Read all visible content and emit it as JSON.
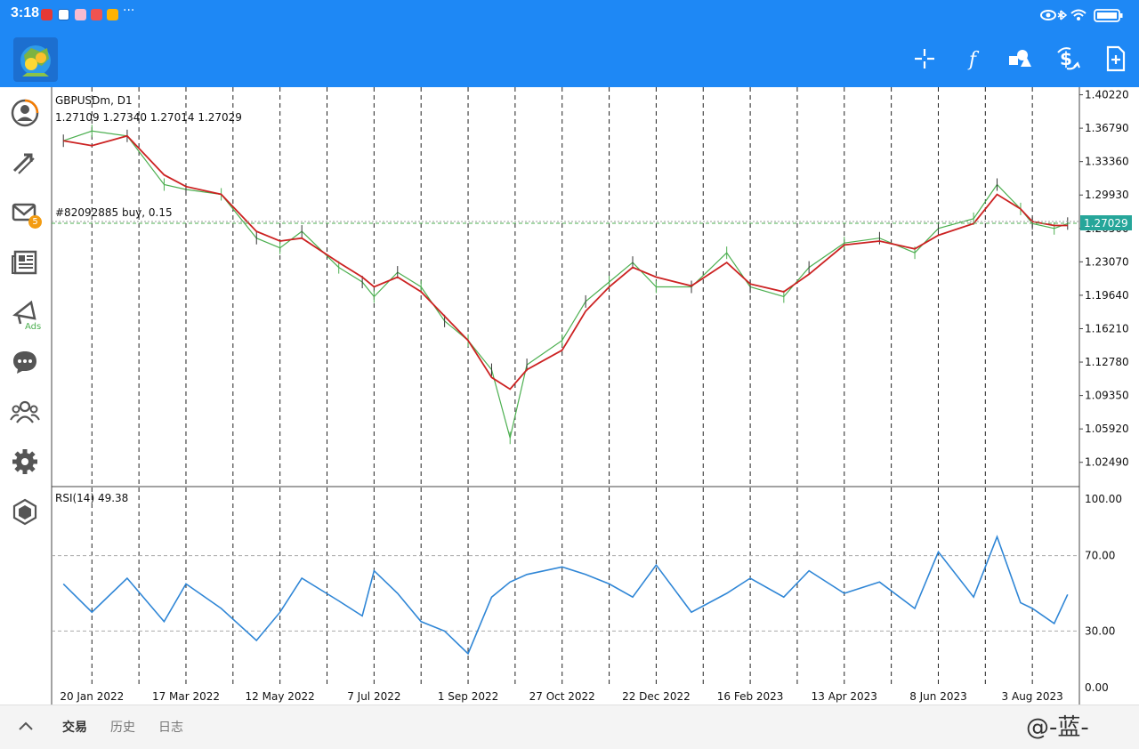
{
  "status_bar": {
    "time": "3:18",
    "colors": {
      "background": "#1e88f5"
    }
  },
  "app_bar": {
    "toolbar_icons": [
      "crosshair-icon",
      "function-icon",
      "shapes-icon",
      "dollar-sync-icon",
      "new-document-icon"
    ]
  },
  "sidebar": {
    "items": [
      {
        "icon": "account-icon"
      },
      {
        "icon": "trade-arrows-icon"
      },
      {
        "icon": "mail-icon",
        "badge": "5"
      },
      {
        "icon": "news-icon"
      },
      {
        "icon": "ads-icon",
        "label": "Ads"
      },
      {
        "icon": "chat-icon"
      },
      {
        "icon": "community-icon"
      },
      {
        "icon": "settings-icon"
      },
      {
        "icon": "mql5-icon"
      }
    ]
  },
  "bottom_bar": {
    "tabs": [
      "交易",
      "历史",
      "日志"
    ],
    "watermark": "@-蓝-"
  },
  "chart_data": {
    "type": "line",
    "symbol_label": "GBPUSDm, D1",
    "ohlc": "1.27109 1.27340 1.27014 1.27029",
    "order_label": "#82092885 buy, 0.15",
    "order_price": 1.27029,
    "current_price_label": "1.27029",
    "price_axis_ticks": [
      "1.40220",
      "1.36790",
      "1.33360",
      "1.29930",
      "1.26500",
      "1.23070",
      "1.19640",
      "1.16210",
      "1.12780",
      "1.09350",
      "1.05920",
      "1.02490"
    ],
    "price_ylim": [
      1.0,
      1.41
    ],
    "date_ticks": [
      "20 Jan 2022",
      "17 Mar 2022",
      "12 May 2022",
      "7 Jul 2022",
      "1 Sep 2022",
      "27 Oct 2022",
      "22 Dec 2022",
      "16 Feb 2023",
      "13 Apr 2023",
      "8 Jun 2023",
      "3 Aug 2023"
    ],
    "series": [
      {
        "kind": "price",
        "x": [
          "2022-01-03",
          "2022-01-20",
          "2022-02-10",
          "2022-03-04",
          "2022-03-17",
          "2022-04-07",
          "2022-04-28",
          "2022-05-12",
          "2022-05-25",
          "2022-06-16",
          "2022-06-30",
          "2022-07-07",
          "2022-07-21",
          "2022-08-04",
          "2022-08-18",
          "2022-09-01",
          "2022-09-15",
          "2022-09-26",
          "2022-10-06",
          "2022-10-27",
          "2022-11-10",
          "2022-11-24",
          "2022-12-08",
          "2022-12-22",
          "2023-01-12",
          "2023-02-02",
          "2023-02-16",
          "2023-03-08",
          "2023-03-23",
          "2023-04-13",
          "2023-05-04",
          "2023-05-25",
          "2023-06-08",
          "2023-06-29",
          "2023-07-13",
          "2023-07-27",
          "2023-08-03",
          "2023-08-16",
          "2023-08-24"
        ],
        "values": [
          1.355,
          1.365,
          1.36,
          1.31,
          1.305,
          1.3,
          1.255,
          1.245,
          1.262,
          1.225,
          1.21,
          1.195,
          1.22,
          1.205,
          1.17,
          1.15,
          1.12,
          1.05,
          1.125,
          1.15,
          1.19,
          1.21,
          1.23,
          1.205,
          1.205,
          1.24,
          1.205,
          1.195,
          1.225,
          1.25,
          1.255,
          1.24,
          1.265,
          1.275,
          1.31,
          1.285,
          1.27,
          1.265,
          1.27
        ]
      },
      {
        "kind": "moving_average",
        "color": "#cc2222",
        "x": [
          "2022-01-03",
          "2022-01-20",
          "2022-02-10",
          "2022-03-04",
          "2022-03-17",
          "2022-04-07",
          "2022-04-28",
          "2022-05-12",
          "2022-05-25",
          "2022-06-16",
          "2022-06-30",
          "2022-07-07",
          "2022-07-21",
          "2022-08-04",
          "2022-08-18",
          "2022-09-01",
          "2022-09-15",
          "2022-09-26",
          "2022-10-06",
          "2022-10-27",
          "2022-11-10",
          "2022-11-24",
          "2022-12-08",
          "2022-12-22",
          "2023-01-12",
          "2023-02-02",
          "2023-02-16",
          "2023-03-08",
          "2023-03-23",
          "2023-04-13",
          "2023-05-04",
          "2023-05-25",
          "2023-06-08",
          "2023-06-29",
          "2023-07-13",
          "2023-07-27",
          "2023-08-03",
          "2023-08-16",
          "2023-08-24"
        ],
        "values": [
          1.355,
          1.35,
          1.36,
          1.32,
          1.308,
          1.3,
          1.262,
          1.252,
          1.255,
          1.23,
          1.215,
          1.205,
          1.215,
          1.2,
          1.175,
          1.15,
          1.112,
          1.1,
          1.12,
          1.14,
          1.18,
          1.205,
          1.225,
          1.215,
          1.206,
          1.23,
          1.208,
          1.2,
          1.218,
          1.248,
          1.252,
          1.244,
          1.258,
          1.27,
          1.3,
          1.285,
          1.272,
          1.268,
          1.268
        ]
      }
    ],
    "rsi": {
      "label": "RSI(14) 49.38",
      "color": "#2f86d6",
      "levels": [
        30,
        70
      ],
      "ticks": [
        "100.00",
        "70.00",
        "30.00",
        "0.00"
      ],
      "ylim": [
        0,
        100
      ],
      "x": [
        "2022-01-03",
        "2022-01-20",
        "2022-02-10",
        "2022-03-04",
        "2022-03-17",
        "2022-04-07",
        "2022-04-28",
        "2022-05-12",
        "2022-05-25",
        "2022-06-16",
        "2022-06-30",
        "2022-07-07",
        "2022-07-21",
        "2022-08-04",
        "2022-08-18",
        "2022-09-01",
        "2022-09-15",
        "2022-09-26",
        "2022-10-06",
        "2022-10-27",
        "2022-11-10",
        "2022-11-24",
        "2022-12-08",
        "2022-12-22",
        "2023-01-12",
        "2023-02-02",
        "2023-02-16",
        "2023-03-08",
        "2023-03-23",
        "2023-04-13",
        "2023-05-04",
        "2023-05-25",
        "2023-06-08",
        "2023-06-29",
        "2023-07-13",
        "2023-07-27",
        "2023-08-03",
        "2023-08-16",
        "2023-08-24"
      ],
      "values": [
        55,
        40,
        58,
        35,
        55,
        42,
        25,
        40,
        58,
        46,
        38,
        62,
        50,
        35,
        30,
        18,
        48,
        56,
        60,
        64,
        60,
        55,
        48,
        65,
        40,
        50,
        58,
        48,
        62,
        50,
        56,
        42,
        72,
        48,
        80,
        45,
        42,
        34,
        49.38
      ]
    }
  }
}
